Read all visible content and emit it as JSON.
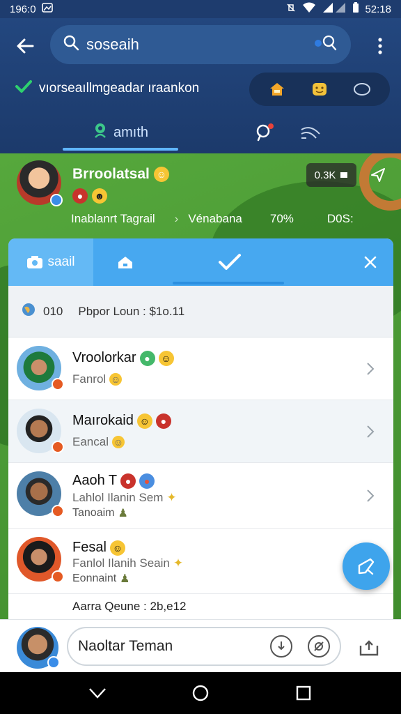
{
  "status_bar": {
    "time": "196:0",
    "clock": "52:18"
  },
  "search": {
    "query": "soseaih"
  },
  "account": {
    "verified_text": "vıorseaıllmgeadar ıraankon"
  },
  "tabs": {
    "main_label": "amıth"
  },
  "profile": {
    "name": "Brroolatsal",
    "counter": "0.3K",
    "stats": {
      "location": "Inablanrt Tagrail",
      "separator": "›",
      "label": "Vénabana",
      "percent": "70%",
      "extra": "D0S:"
    }
  },
  "card": {
    "tab_label": "saail",
    "filter": {
      "count": "010",
      "text": "Pbpor Loun : $1o.11"
    },
    "items": [
      {
        "name": "Vroolorkar",
        "sub": "Fanrol"
      },
      {
        "name": "Maırokaid",
        "sub": "Eancal"
      },
      {
        "name": "Aaoh T",
        "sub": "Lahlol Ilanin Sem",
        "sub2": "Tanoaim"
      },
      {
        "name": "Fesal",
        "sub": "Fanlol Ilanih Seain",
        "sub2": "Eonnaint"
      }
    ],
    "summary": "Aarra Qeune : 2b,e12"
  },
  "composer": {
    "placeholder": "Naoltar Teman"
  },
  "colors": {
    "header": "#23477f",
    "accent": "#47a8f0",
    "green_bg": "#4b9a35"
  }
}
